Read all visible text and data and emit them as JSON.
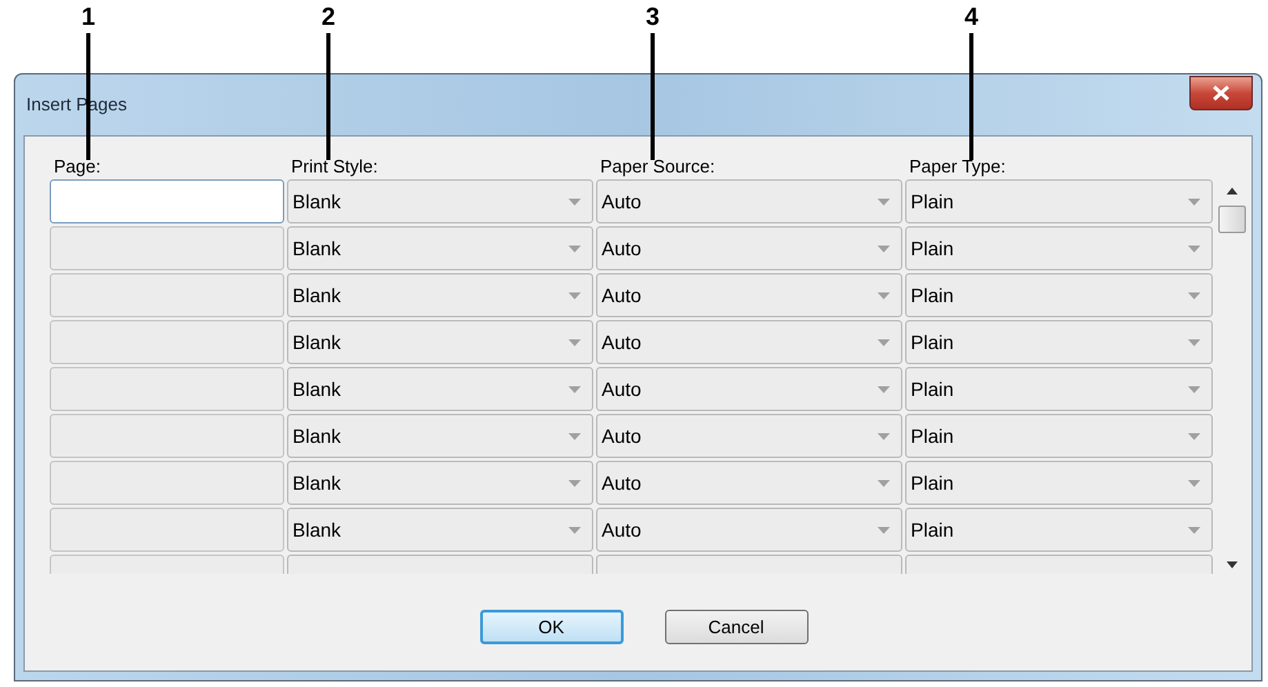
{
  "callouts": [
    {
      "label": "1"
    },
    {
      "label": "2"
    },
    {
      "label": "3"
    },
    {
      "label": "4"
    }
  ],
  "window": {
    "title": "Insert Pages"
  },
  "table": {
    "columns": [
      "Page:",
      "Print Style:",
      "Paper Source:",
      "Paper Type:"
    ],
    "rows": [
      {
        "page_disabled": false,
        "print_style": "Blank",
        "paper_source": "Auto",
        "paper_type": "Plain"
      },
      {
        "page_disabled": true,
        "print_style": "Blank",
        "paper_source": "Auto",
        "paper_type": "Plain"
      },
      {
        "page_disabled": true,
        "print_style": "Blank",
        "paper_source": "Auto",
        "paper_type": "Plain"
      },
      {
        "page_disabled": true,
        "print_style": "Blank",
        "paper_source": "Auto",
        "paper_type": "Plain"
      },
      {
        "page_disabled": true,
        "print_style": "Blank",
        "paper_source": "Auto",
        "paper_type": "Plain"
      },
      {
        "page_disabled": true,
        "print_style": "Blank",
        "paper_source": "Auto",
        "paper_type": "Plain"
      },
      {
        "page_disabled": true,
        "print_style": "Blank",
        "paper_source": "Auto",
        "paper_type": "Plain"
      },
      {
        "page_disabled": true,
        "print_style": "Blank",
        "paper_source": "Auto",
        "paper_type": "Plain"
      }
    ],
    "more_rows_below": true
  },
  "buttons": [
    {
      "label": "OK",
      "default": true
    },
    {
      "label": "Cancel",
      "default": false
    }
  ]
}
